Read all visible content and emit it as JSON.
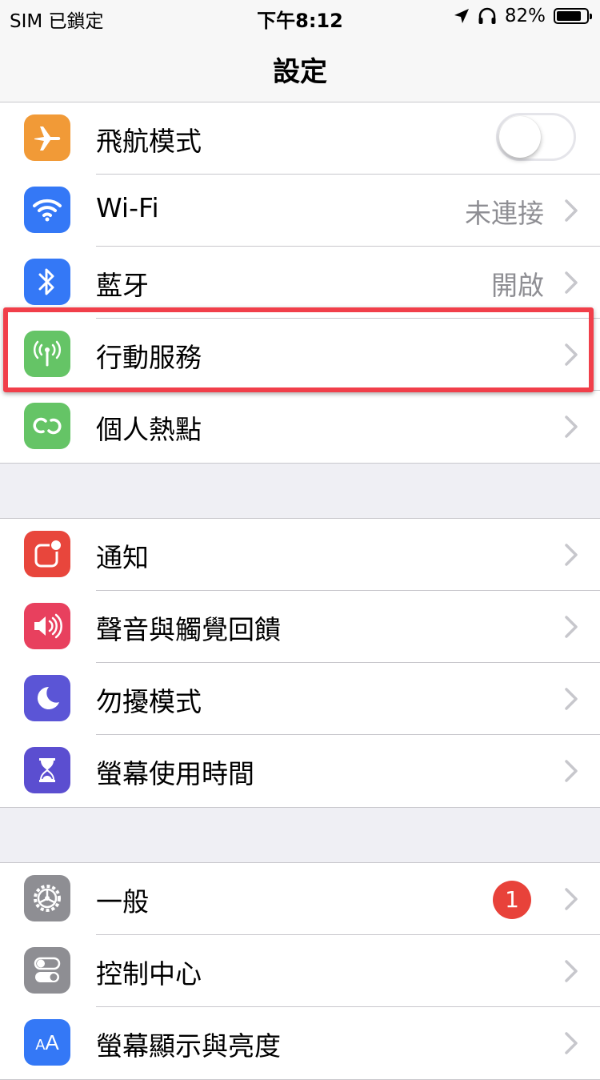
{
  "status_bar": {
    "carrier": "SIM 已鎖定",
    "time": "下午8:12",
    "battery": "82%",
    "battery_level": 0.82
  },
  "nav": {
    "title": "設定"
  },
  "groups": [
    {
      "rows": [
        {
          "label": "飛航模式",
          "icon": "airplane-icon",
          "color": "#f19a37",
          "control": "toggle",
          "on": false
        },
        {
          "label": "Wi-Fi",
          "icon": "wifi-icon",
          "color": "#3478f6",
          "value": "未連接"
        },
        {
          "label": "藍牙",
          "icon": "bluetooth-icon",
          "color": "#3478f6",
          "value": "開啟"
        },
        {
          "label": "行動服務",
          "icon": "antenna-icon",
          "color": "#65c466",
          "highlighted": true
        },
        {
          "label": "個人熱點",
          "icon": "hotspot-icon",
          "color": "#65c466"
        }
      ]
    },
    {
      "rows": [
        {
          "label": "通知",
          "icon": "notifications-icon",
          "color": "#e8463c"
        },
        {
          "label": "聲音與觸覺回饋",
          "icon": "speaker-icon",
          "color": "#e8405e"
        },
        {
          "label": "勿擾模式",
          "icon": "moon-icon",
          "color": "#5b55d6"
        },
        {
          "label": "螢幕使用時間",
          "icon": "hourglass-icon",
          "color": "#5b4ed0"
        }
      ]
    },
    {
      "rows": [
        {
          "label": "一般",
          "icon": "gear-icon",
          "color": "#8e8e93",
          "badge": "1"
        },
        {
          "label": "控制中心",
          "icon": "switches-icon",
          "color": "#8e8e93"
        },
        {
          "label": "螢幕顯示與亮度",
          "icon": "text-size-icon",
          "color": "#3478f6",
          "icon_text": "AA"
        }
      ]
    }
  ]
}
